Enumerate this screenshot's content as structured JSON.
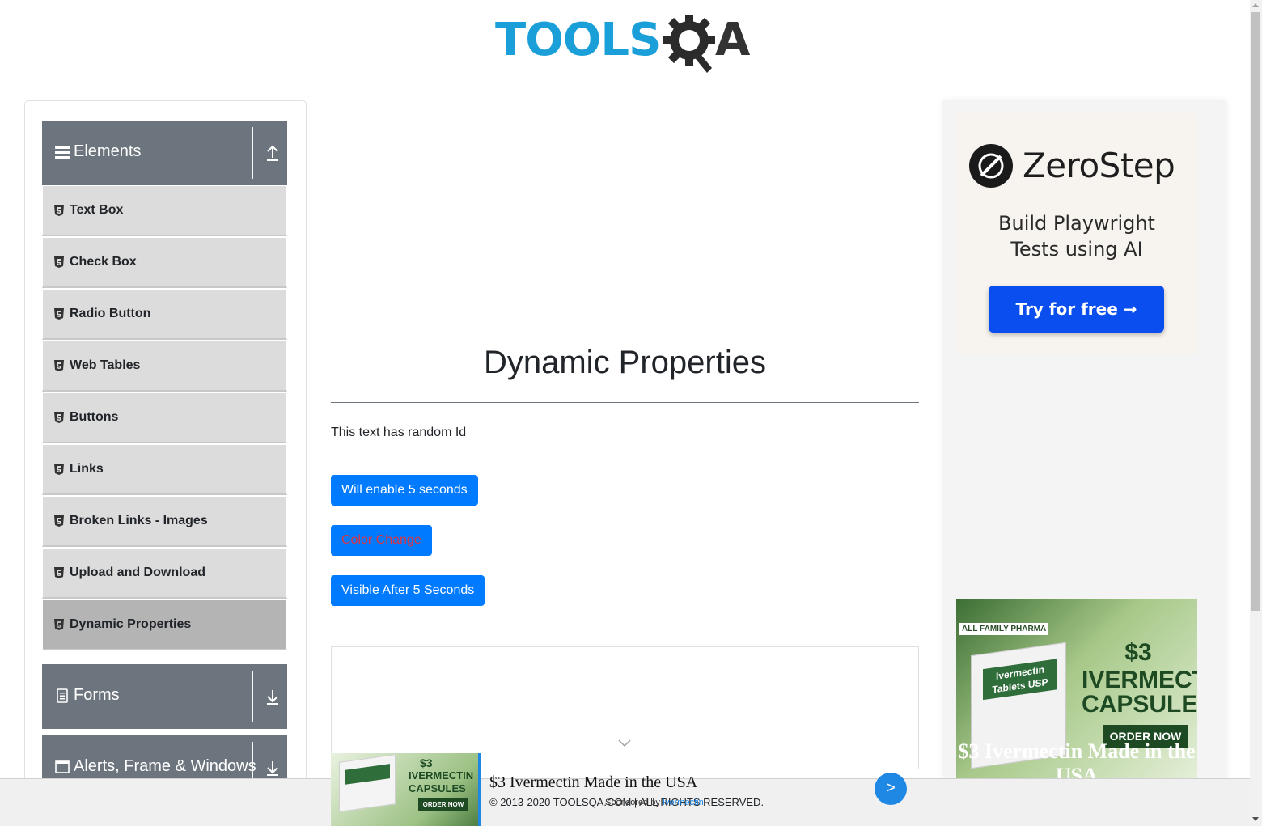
{
  "header": {
    "logo_tools": "TOOLS",
    "logo_qa": "A"
  },
  "sidebar": {
    "elements_group": {
      "label": "Elements",
      "icon": "hamburger-icon",
      "toggle_icon": "collapse-icon"
    },
    "items": [
      {
        "label": "Text Box"
      },
      {
        "label": "Check Box"
      },
      {
        "label": "Radio Button"
      },
      {
        "label": "Web Tables"
      },
      {
        "label": "Buttons"
      },
      {
        "label": "Links"
      },
      {
        "label": "Broken Links - Images"
      },
      {
        "label": "Upload and Download"
      },
      {
        "label": "Dynamic Properties",
        "active": true
      }
    ],
    "forms_group": {
      "label": "Forms",
      "icon": "form-icon",
      "toggle_icon": "expand-icon"
    },
    "alerts_group": {
      "label": "Alerts, Frame & Windows",
      "icon": "window-icon",
      "toggle_icon": "expand-icon"
    }
  },
  "main": {
    "title": "Dynamic Properties",
    "random_text": "This text has random Id",
    "buttons": {
      "enable_after": "Will enable 5 seconds",
      "color_change": "Color Change",
      "visible_after": "Visible After 5 Seconds"
    }
  },
  "right_ads": {
    "zerostep": {
      "brand": "ZeroStep",
      "subtitle": "Build Playwright Tests using AI",
      "cta": "Try for free →"
    },
    "ivermectin": {
      "brand_badge": "ALL FAMILY PHARMA",
      "box_label": "Ivermectin Tablets USP",
      "price": "$3",
      "product": "IVERMECTIN",
      "form": "CAPSULES",
      "order": "ORDER NOW",
      "headline": "$3 Ivermectin Made in the USA"
    }
  },
  "bottom_ad": {
    "price": "$3",
    "product": "IVERMECTIN",
    "form": "CAPSULES",
    "order": "ORDER NOW",
    "headline": "$3 Ivermectin Made in the USA",
    "next": ">"
  },
  "footer": {
    "copyright": "© 2013-2020 TOOLSQA.COM | ALL RIGHTS RESERVED.",
    "sponsored_prefix": "Sponsored by",
    "sponsored_link": "Ivermectin"
  },
  "colors": {
    "accent": "#007bff",
    "sidebar_header": "#6c757d",
    "menu_item": "#dcdcdc",
    "menu_item_active": "#b4b4b4",
    "color_change_text": "#dc3545"
  }
}
